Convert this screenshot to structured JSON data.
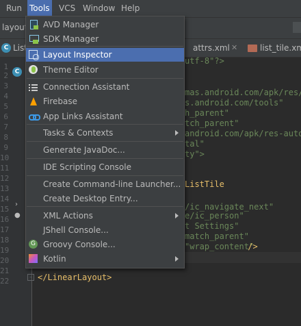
{
  "menubar": {
    "items": [
      "Run",
      "Tools",
      "VCS",
      "Window",
      "Help"
    ],
    "active": "Tools"
  },
  "navbar": {
    "text": "layout"
  },
  "tabs": {
    "first": "List",
    "second": "attrs.xml",
    "third": "list_tile.xml"
  },
  "editor": {
    "line_numbers": [
      "1",
      "2",
      "3",
      "4",
      "5",
      "6",
      "7",
      "8",
      "9",
      "10",
      "11",
      "12",
      "13",
      "14",
      "15",
      "16",
      "17",
      "18",
      "19",
      "20",
      "21",
      "22"
    ],
    "lines": {
      "l1": "utf-8\"?>",
      "l3": "mas.android.com/apk/res/a",
      "l4": "s.android.com/tools\"",
      "l5": "h_parent\"",
      "l6": "tch_parent\"",
      "l7": "android.com/apk/res-auto\"",
      "l8": "tal\"",
      "l9": "ty\">",
      "l12": "ListTile",
      "l15": "/ic_navigate_next\"",
      "l16": "e/ic_person\"",
      "l17": "t Settings\"",
      "l18": "match_parent\"",
      "l19": "\"wrap_content\"",
      "l19_end": " />",
      "l22": "</LinearLayout>"
    }
  },
  "tools_menu": {
    "items": [
      {
        "label": "AVD Manager",
        "icon": "avd-manager-icon"
      },
      {
        "label": "SDK Manager",
        "icon": "sdk-manager-icon"
      },
      {
        "label": "Layout Inspector",
        "icon": "layout-inspector-icon",
        "active": true
      },
      {
        "label": "Theme Editor",
        "icon": "theme-editor-icon"
      },
      {
        "label": "Connection Assistant",
        "icon": "connection-assistant-icon"
      },
      {
        "label": "Firebase",
        "icon": "firebase-icon"
      },
      {
        "label": "App Links Assistant",
        "icon": "app-links-icon"
      },
      {
        "label": "Tasks & Contexts",
        "icon": "",
        "submenu": true
      },
      {
        "label": "Generate JavaDoc...",
        "icon": ""
      },
      {
        "label": "IDE Scripting Console",
        "icon": ""
      },
      {
        "label": "Create Command-line Launcher...",
        "icon": ""
      },
      {
        "label": "Create Desktop Entry...",
        "icon": ""
      },
      {
        "label": "XML Actions",
        "icon": "",
        "submenu": true
      },
      {
        "label": "JShell Console...",
        "icon": ""
      },
      {
        "label": "Groovy Console...",
        "icon": "groovy-icon"
      },
      {
        "label": "Kotlin",
        "icon": "kotlin-icon",
        "submenu": true
      }
    ]
  },
  "colors": {
    "background": "#2b2b2b",
    "menu_bg": "#3c3f41",
    "selection": "#4b6eaf",
    "string": "#6a8759",
    "tag": "#e8bf6a"
  }
}
